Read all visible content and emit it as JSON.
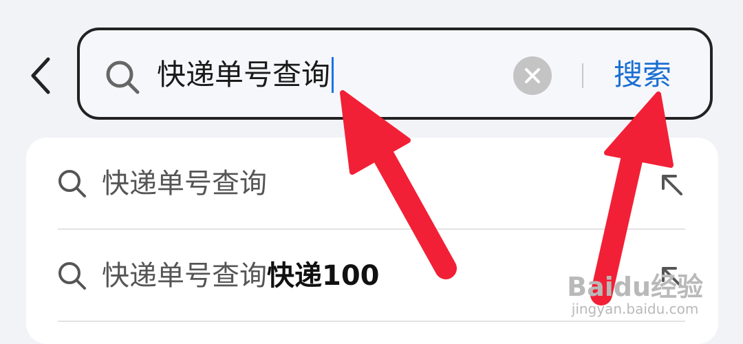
{
  "search": {
    "query": "快递单号查询",
    "search_button_label": "搜索"
  },
  "suggestions": [
    {
      "text_plain": "快递单号查询",
      "text_bold": ""
    },
    {
      "text_plain": "快递单号查询",
      "text_bold": "快递100"
    }
  ],
  "watermark": {
    "logo": "Baidu经验",
    "url": "jingyan.baidu.com"
  },
  "colors": {
    "accent": "#1a6fd1",
    "annotation_arrow": "#f22036",
    "background": "#f2f3f7"
  },
  "icons": [
    "back-arrow-icon",
    "search-icon",
    "clear-icon",
    "fill-arrow-icon"
  ]
}
